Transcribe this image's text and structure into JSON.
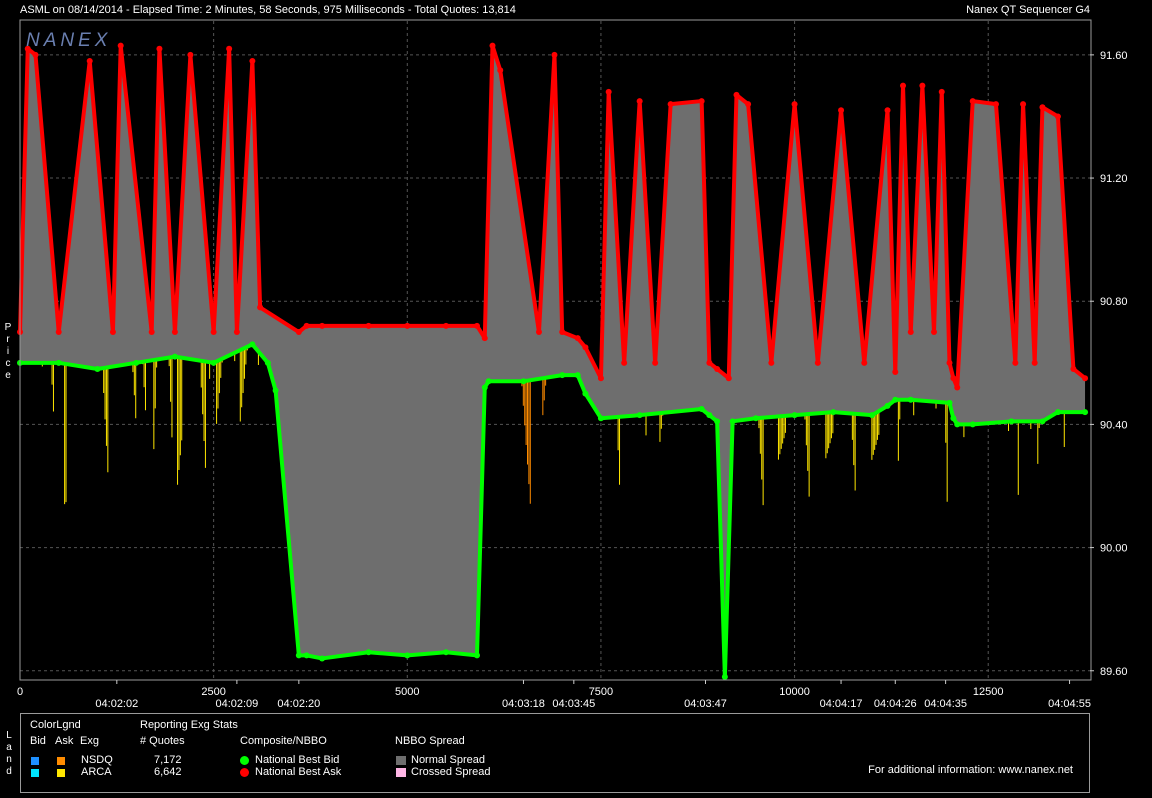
{
  "header": {
    "title": "ASML on 08/14/2014  -  Elapsed Time: 2 Minutes, 58 Seconds, 975 Milliseconds  -  Total Quotes: 13,814",
    "app_name": "Nanex QT Sequencer G4",
    "watermark": "NANEX"
  },
  "side_labels": {
    "price": "Price",
    "legend": "Land"
  },
  "colors": {
    "nsdq_bid": "#1E90FF",
    "nsdq_ask": "#FF8C00",
    "arca_bid": "#00E5FF",
    "arca_ask": "#FFE600",
    "nbbo_bid": "#00FF00",
    "nbbo_ask": "#FF0000",
    "normal_spread": "#6E6E6E",
    "crossed_spread": "#FFB6E6",
    "grid": "#555555"
  },
  "legend": {
    "color_legend_title": "ColorLgnd",
    "col_bid": "Bid",
    "col_ask": "Ask",
    "col_exg": "Exg",
    "stats_title": "Reporting Exg Stats",
    "quotes_header": "# Quotes",
    "composite_title": "Composite/NBBO",
    "spread_title": "NBBO Spread",
    "exchanges": [
      {
        "name": "NSDQ",
        "quotes": "7,172"
      },
      {
        "name": "ARCA",
        "quotes": "6,642"
      }
    ],
    "composite": [
      "National Best Bid",
      "National Best Ask"
    ],
    "spread": [
      "Normal Spread",
      "Crossed Spread"
    ],
    "footer": "For additional information: www.nanex.net"
  },
  "chart_data": {
    "type": "line",
    "title": "ASML on 08/14/2014",
    "xlim": [
      0,
      13814
    ],
    "ylim": [
      89.57,
      91.71
    ],
    "y_ticks": [
      "91.60",
      "91.20",
      "90.80",
      "90.40",
      "90.00",
      "89.60"
    ],
    "x_ticks": [
      "0",
      "2500",
      "5000",
      "7500",
      "10000",
      "12500"
    ],
    "time_labels": [
      {
        "x": 1250,
        "label": "04:02:02"
      },
      {
        "x": 2800,
        "label": "04:02:09"
      },
      {
        "x": 3600,
        "label": "04:02:20"
      },
      {
        "x": 6500,
        "label": "04:03:18"
      },
      {
        "x": 7150,
        "label": "04:03:45"
      },
      {
        "x": 8850,
        "label": "04:03:47"
      },
      {
        "x": 10600,
        "label": "04:04:17"
      },
      {
        "x": 11300,
        "label": "04:04:26"
      },
      {
        "x": 11950,
        "label": "04:04:35"
      },
      {
        "x": 13550,
        "label": "04:04:55"
      }
    ],
    "series": [
      {
        "name": "National Best Ask",
        "x": [
          0,
          100,
          200,
          500,
          900,
          1200,
          1300,
          1700,
          1800,
          2000,
          2200,
          2500,
          2700,
          2800,
          3000,
          3100,
          3600,
          3700,
          3900,
          4500,
          5000,
          5500,
          5900,
          6000,
          6100,
          6200,
          6700,
          6900,
          7000,
          7200,
          7300,
          7500,
          7600,
          7800,
          8000,
          8200,
          8400,
          8800,
          8900,
          9000,
          9150,
          9250,
          9400,
          9700,
          10000,
          10300,
          10600,
          10900,
          11200,
          11300,
          11400,
          11500,
          11650,
          11800,
          11900,
          12000,
          12050,
          12100,
          12300,
          12600,
          12850,
          12950,
          13100,
          13200,
          13400,
          13600,
          13750
        ],
        "y": [
          90.7,
          91.62,
          91.6,
          90.7,
          91.58,
          90.7,
          91.63,
          90.7,
          91.62,
          90.7,
          91.6,
          90.7,
          91.62,
          90.7,
          91.58,
          90.78,
          90.7,
          90.72,
          90.72,
          90.72,
          90.72,
          90.72,
          90.72,
          90.68,
          91.63,
          91.55,
          90.7,
          91.6,
          90.7,
          90.68,
          90.65,
          90.55,
          91.48,
          90.6,
          91.45,
          90.6,
          91.44,
          91.45,
          90.6,
          90.58,
          90.55,
          91.47,
          91.44,
          90.6,
          91.44,
          90.6,
          91.42,
          90.6,
          91.42,
          90.57,
          91.5,
          90.7,
          91.5,
          90.7,
          91.48,
          90.6,
          90.55,
          90.52,
          91.45,
          91.44,
          90.6,
          91.44,
          90.6,
          91.43,
          91.4,
          90.58,
          90.55
        ]
      },
      {
        "name": "National Best Bid",
        "x": [
          0,
          500,
          1000,
          1500,
          2000,
          2500,
          3000,
          3200,
          3300,
          3600,
          3700,
          3900,
          4500,
          5000,
          5500,
          5900,
          6000,
          6050,
          6500,
          7000,
          7200,
          7300,
          7500,
          8000,
          8800,
          8900,
          9000,
          9100,
          9200,
          9500,
          10000,
          10500,
          11000,
          11200,
          11300,
          11500,
          12000,
          12050,
          12100,
          12300,
          12800,
          13200,
          13400,
          13750
        ],
        "y": [
          90.6,
          90.6,
          90.58,
          90.6,
          90.62,
          90.6,
          90.66,
          90.6,
          90.51,
          89.65,
          89.65,
          89.64,
          89.66,
          89.65,
          89.66,
          89.65,
          90.52,
          90.54,
          90.54,
          90.56,
          90.56,
          90.5,
          90.42,
          90.43,
          90.45,
          90.43,
          90.41,
          89.58,
          90.41,
          90.42,
          90.43,
          90.44,
          90.43,
          90.46,
          90.48,
          90.48,
          90.47,
          90.42,
          90.4,
          90.4,
          90.41,
          90.41,
          90.44,
          90.44
        ]
      }
    ]
  }
}
